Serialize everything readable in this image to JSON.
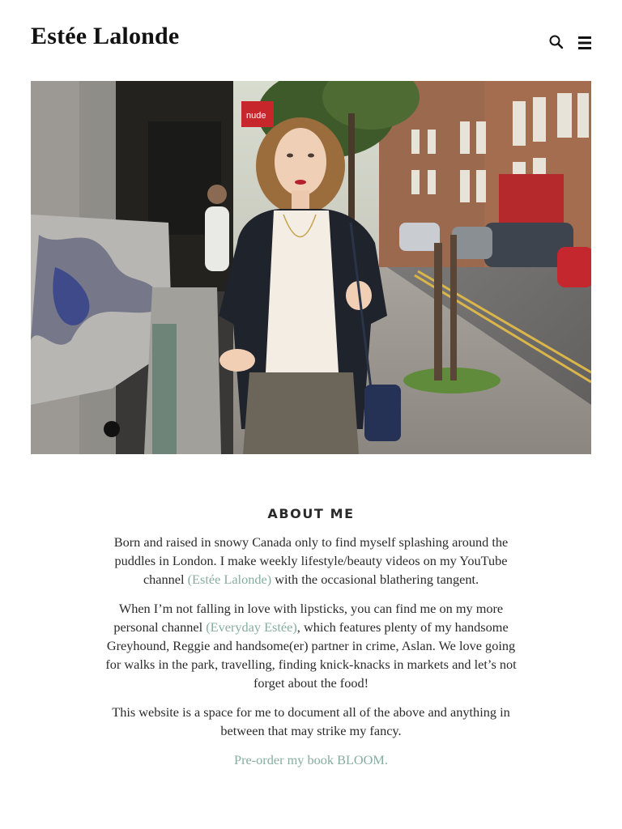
{
  "site": {
    "logo": "Estée Lalonde"
  },
  "header": {
    "search_icon": "search-icon",
    "menu_icon": "hamburger-menu-icon"
  },
  "hero": {
    "shop_sign": "nude"
  },
  "about": {
    "title": "ABOUT ME",
    "p1_before": "Born and raised in snowy Canada only to find myself splashing around the puddles in London. I make weekly lifestyle/beauty videos on my YouTube channel ",
    "p1_link": "(Estée Lalonde)",
    "p1_after": " with the occasional blathering tangent.",
    "p2_before": "When I’m not falling in love with lipsticks, you can find me on my more personal channel ",
    "p2_link": "(Everyday Estée)",
    "p2_after": ", which features plenty of my handsome Greyhound, Reggie and handsome(er) partner in crime, Aslan. We love going for walks in the park, travelling, finding knick-knacks in markets and let’s not forget about the food!",
    "p3": "This website is a space for me to document all of the above and anything in between that may strike my fancy.",
    "cta": "Pre-order my book BLOOM."
  },
  "colors": {
    "link": "#86aca0",
    "text": "#2a2a2a",
    "background": "#ffffff"
  }
}
